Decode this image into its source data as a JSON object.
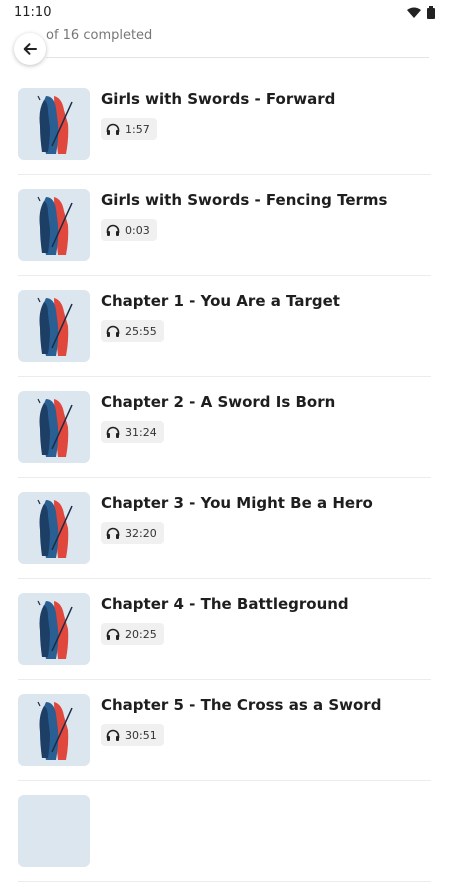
{
  "status_bar": {
    "time": "11:10",
    "wifi_icon": "wifi-icon",
    "battery_icon": "battery-icon"
  },
  "header": {
    "progress_text": "of 16 completed",
    "back_icon": "arrow-left-icon"
  },
  "episodes": [
    {
      "title": "Girls with Swords - Forward",
      "duration": "1:57"
    },
    {
      "title": "Girls with Swords - Fencing Terms",
      "duration": "0:03"
    },
    {
      "title": "Chapter 1 - You Are a Target",
      "duration": "25:55"
    },
    {
      "title": "Chapter 2 - A Sword Is Born",
      "duration": "31:24"
    },
    {
      "title": "Chapter 3 - You Might Be a Hero",
      "duration": "32:20"
    },
    {
      "title": "Chapter 4 - The Battleground",
      "duration": "20:25"
    },
    {
      "title": "Chapter 5 - The Cross as a Sword",
      "duration": "30:51"
    },
    {
      "title": "",
      "duration": ""
    }
  ],
  "colors": {
    "thumb_bg": "#dce6ee",
    "figure_blue": "#2a5f93",
    "figure_red": "#e0473d",
    "chip_bg": "#f0f0f0"
  }
}
